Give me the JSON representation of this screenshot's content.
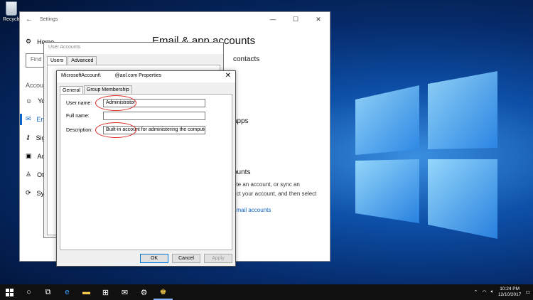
{
  "desktop": {
    "recycle_label": "Recycle"
  },
  "settings": {
    "title": "Settings",
    "home_label": "Home",
    "find_placeholder": "Find",
    "section_label": "Accoun",
    "nav": [
      {
        "label": "Yo",
        "icon": "person-icon"
      },
      {
        "label": "Em",
        "icon": "mail-icon"
      },
      {
        "label": "Sig",
        "icon": "key-icon"
      },
      {
        "label": "Ac",
        "icon": "briefcase-icon"
      },
      {
        "label": "Ot",
        "icon": "person-add-icon"
      },
      {
        "label": "Syi",
        "icon": "sync-icon"
      }
    ],
    "page_title": "Email & app accounts",
    "contacts_heading": "contacts",
    "apps_heading": "apps",
    "accounts_heading": "ounts",
    "body_line1": "ete an account, or sync an",
    "body_line2": "ect your account, and then select",
    "link_text": "email accounts"
  },
  "user_accounts": {
    "title": "User Accounts",
    "tabs": [
      "Users",
      "Advanced"
    ]
  },
  "properties": {
    "title_left": "MicrosoftAccount\\",
    "title_right": "@aol.com Properties",
    "tabs": [
      "General",
      "Group Membership"
    ],
    "user_name_label": "User name:",
    "user_name_value": "Administrator",
    "full_name_label": "Full name:",
    "full_name_value": "",
    "description_label": "Description:",
    "description_value": "Built-in account for administering the computer",
    "ok_label": "OK",
    "cancel_label": "Cancel",
    "apply_label": "Apply"
  },
  "taskbar": {
    "time": "10:24 PM",
    "date": "12/10/2017"
  }
}
